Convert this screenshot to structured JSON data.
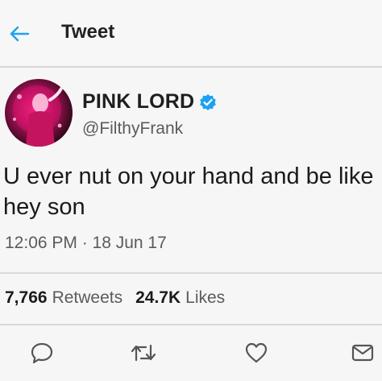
{
  "header": {
    "title": "Tweet",
    "back_icon": "arrow-left-icon"
  },
  "tweet": {
    "display_name": "PINK LORD",
    "verified_icon": "verified-badge-icon",
    "handle": "@FilthyFrank",
    "text": "U ever nut on your hand and be like hey son",
    "timestamp": "12:06 PM · 18 Jun 17"
  },
  "stats": {
    "retweets_count": "7,766",
    "retweets_label": "Retweets",
    "likes_count": "24.7K",
    "likes_label": "Likes"
  },
  "actions": {
    "reply_icon": "reply-icon",
    "retweet_icon": "retweet-icon",
    "like_icon": "heart-icon",
    "message_icon": "envelope-icon"
  },
  "colors": {
    "back_arrow": "#1da1f2",
    "verified": "#1da1f2",
    "text": "#1a1a1a",
    "secondary_text": "#5b5b5b",
    "icon": "#555555",
    "avatar_accent": "#ff2b8a"
  }
}
